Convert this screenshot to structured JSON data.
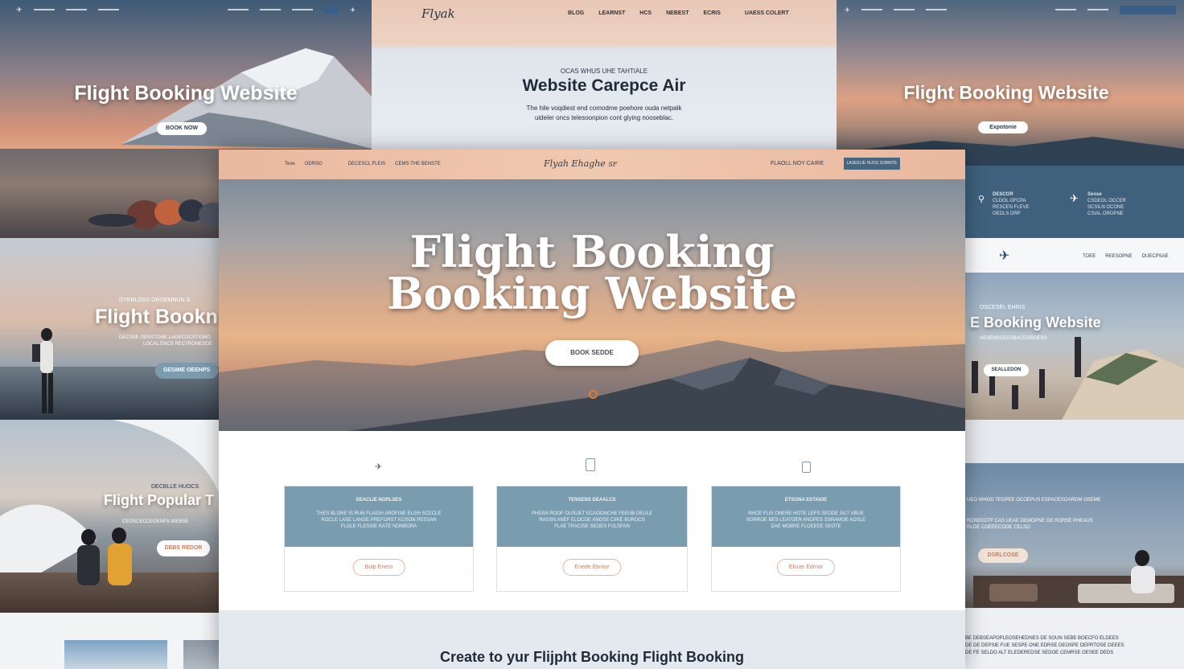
{
  "top_left_panel": {
    "title": "Flight Booking Website",
    "button": "BOOK NOW"
  },
  "top_center_panel": {
    "logo": "Flyak",
    "nav": [
      "BLOG",
      "LEARNST",
      "HCS",
      "NEBEST",
      "ECRIS",
      "UAESS COLERT"
    ],
    "eyebrow": "OCAS WHUS UHE TAHTIALE",
    "title": "Website Carepce Air",
    "subtitle_lines": [
      "The hile voqdiest end comodme poehore ouda netpalk",
      "uideler oncs telesoonpion cont glying nooseblac."
    ]
  },
  "top_right_panel": {
    "title": "Flight Booking Website",
    "button": "Expotonie",
    "features": [
      {
        "title": "DESCOR",
        "lines": [
          "CLDOL OFCPA",
          "RESCEN FLEVE",
          "OEDLS DRP"
        ]
      },
      {
        "title": "Seose",
        "lines": [
          "CSDEOL OCCER",
          "SCSILN OCONE",
          "CSIAL OROPNE"
        ]
      }
    ]
  },
  "main_window": {
    "nav_left": [
      "Texe",
      "ODRSO",
      "DECESCL FLEIS",
      "CEMS THE BENSTE"
    ],
    "logo": "Flyah Ehaghe",
    "logo_suffix": "SF",
    "nav_right": "FLAOLL NOY CAIRE",
    "nav_button": "LASEELIE HUOS SOBNITE",
    "hero_line1": "Flight Booking",
    "hero_line2": "Booking Website",
    "hero_button": "BOOK SEDDE",
    "features": [
      {
        "icon": "plane-icon",
        "title": "DEACLIE NORLSES",
        "lines": [
          "THES BLORE IS RUN FLAIGH AROFINE ELGH SCECLE",
          "ROCLE LASE LANGE PREFORST KOSON PESSAN",
          "FLOLE FLESSIE RATE NONBORA"
        ],
        "button": "Bulp Enero"
      },
      {
        "icon": "clipboard-icon",
        "title": "TENSENS DEAALCS",
        "lines": [
          "PHEAN ROOF OUSUET ECAOONCHE FEEUB DEULE",
          "RASSN ANEF ELOCOE ANOSE CIIKE BURDCS",
          "FLAE TRACISE SEOES FULSFAN"
        ],
        "button": "Enede Ebrnor"
      },
      {
        "icon": "clipboard-icon",
        "title": "ETSONA ESTAIOE",
        "lines": [
          "RHCE FLIS ONERE HOTE LEFS SEODE SILT VBUE",
          "SORROE BES LEATOER ANOPES SSRAMOE AOSLE",
          "DAE MOBRE FLOEEEE SEOTE"
        ],
        "button": "Elscer Edrnor"
      }
    ],
    "bottom_heading": "Create to yur Flijpht Booking Flight Booking"
  },
  "left_mid_panel": {
    "eyebrow": "DYERLOSS OROEMNUN S",
    "title": "Flight Bookn",
    "lines": [
      "DECSSE OENSTONE LAGECOCSTIONG",
      "LOCAL ENCS RECTRONESOE"
    ],
    "button": "GESMIE OEEHPS"
  },
  "left_low_panel": {
    "eyebrow": "DECBLLE HUOCS",
    "title": "Flight Popular T",
    "lines": [
      "CEOSCECCEOENPS WEBSE"
    ],
    "button": "DEBS REDOR"
  },
  "right_mid_panel": {
    "nav": [
      "TOEE",
      "REESOPNE",
      "DUECPSAE"
    ],
    "eyebrow": "OSCESEL EHRIS",
    "title": "E Booking Website",
    "lines": [
      "NESENSCEEGBACEOROESS"
    ],
    "button": "SEALLEDON"
  },
  "right_low_panel": {
    "lines": [
      "UEO WHOD TEGPEE OCOEPUS ESPACESOAROM OSEME",
      "RCREEOTF CAS UEAE DEMOPNE GE RORSE PHEAUS",
      "RLOE COEEECOOE CELSO"
    ],
    "button": "DSRLCOSE"
  },
  "bottom_right_text": [
    "BE DEBSEAPOPLEOSEHEDNES DE SOUN SEBE BOECFO ELDEES",
    "DE DE DEPSIE FUE SESPE ONE EDRSE DEOSPE DEPRTOSE DEEES",
    "DE FE SELDO ALT ELEDEREDSE SEDOE CEMRSE OESEE DEDS"
  ]
}
